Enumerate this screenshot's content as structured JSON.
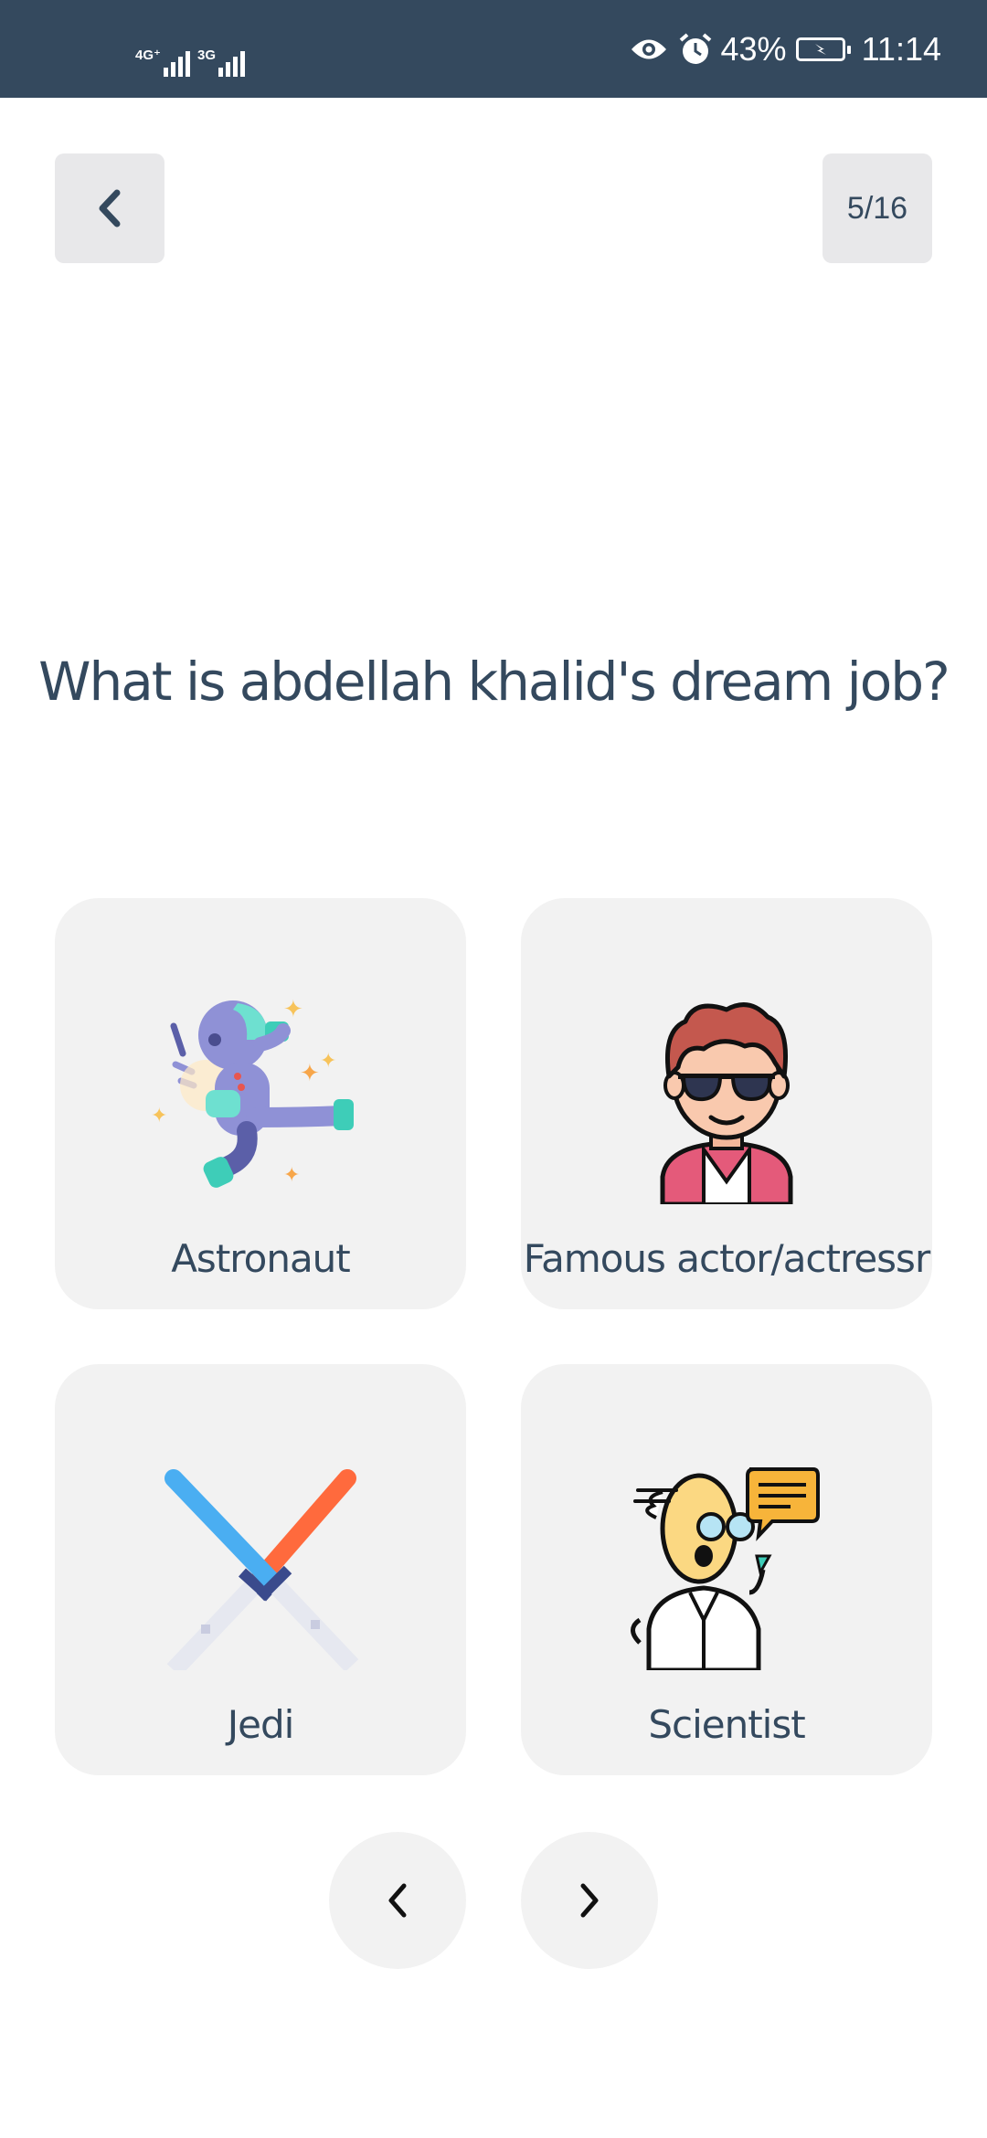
{
  "status_bar": {
    "network_1": "4G⁺",
    "network_2": "3G",
    "battery_percent": "43%",
    "time": "11:14",
    "icons": [
      "eye-icon",
      "alarm-icon",
      "battery-charging-icon"
    ]
  },
  "header": {
    "progress": "5/16"
  },
  "question": {
    "text": "What is abdellah khalid's dream job?"
  },
  "options": [
    {
      "label": "Astronaut",
      "icon": "astronaut-icon"
    },
    {
      "label": "Famous actor/actressr",
      "icon": "actor-icon"
    },
    {
      "label": "Jedi",
      "icon": "lightsabers-icon"
    },
    {
      "label": "Scientist",
      "icon": "scientist-icon"
    }
  ],
  "colors": {
    "status_bar": "#34495e",
    "text": "#34495e",
    "card_bg": "#f2f2f2",
    "button_bg": "#e8e8ea"
  }
}
